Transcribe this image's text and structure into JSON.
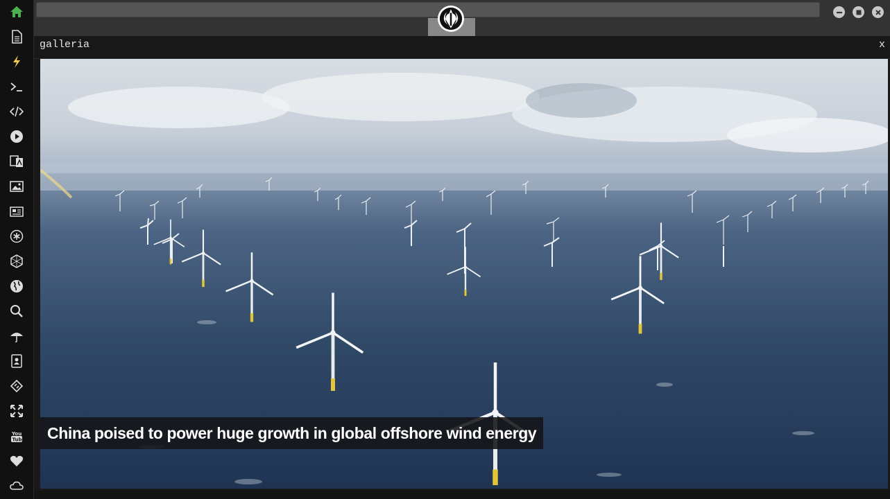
{
  "window": {
    "app_logo": "rebel-alliance-logo",
    "controls": [
      "minimize-icon",
      "maximize-icon",
      "close-icon"
    ]
  },
  "sidebar": {
    "accent_color": "#4caf50",
    "items": [
      {
        "name": "home",
        "icon": "home-icon",
        "active": true
      },
      {
        "name": "document",
        "icon": "document-icon"
      },
      {
        "name": "lightning",
        "icon": "lightning-icon",
        "accent": "#f2c94c"
      },
      {
        "name": "terminal",
        "icon": "terminal-icon"
      },
      {
        "name": "code",
        "icon": "code-icon"
      },
      {
        "name": "play",
        "icon": "play-icon"
      },
      {
        "name": "translate",
        "icon": "translate-icon"
      },
      {
        "name": "image",
        "icon": "image-icon"
      },
      {
        "name": "news",
        "icon": "newspaper-icon"
      },
      {
        "name": "asterisk",
        "icon": "asterisk-icon"
      },
      {
        "name": "hexagon",
        "icon": "hexagon-icon"
      },
      {
        "name": "globe",
        "icon": "globe-icon"
      },
      {
        "name": "search",
        "icon": "search-icon"
      },
      {
        "name": "umbrella",
        "icon": "umbrella-icon"
      },
      {
        "name": "contacts",
        "icon": "contact-book-icon"
      },
      {
        "name": "diamond",
        "icon": "diamond-code-icon"
      },
      {
        "name": "fullscreen",
        "icon": "expand-icon"
      },
      {
        "name": "youtube",
        "icon": "youtube-icon"
      },
      {
        "name": "heart",
        "icon": "heart-icon"
      },
      {
        "name": "cloud",
        "icon": "cloud-icon"
      }
    ]
  },
  "panel": {
    "title": "galleria",
    "close_label": "x"
  },
  "gallery": {
    "caption": "China poised to power huge growth in global offshore wind energy",
    "image_subject": "offshore-wind-farm-photo"
  }
}
